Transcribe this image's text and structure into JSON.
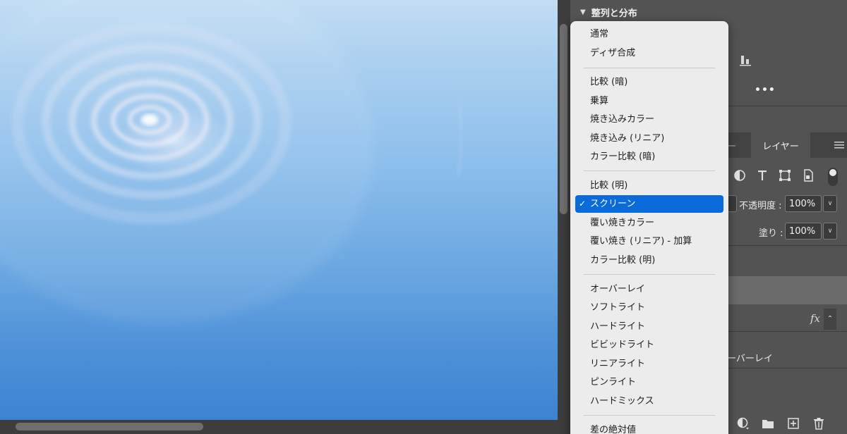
{
  "canvas": {
    "gradient_top": "#c2ddf3",
    "gradient_bottom": "#3d83d2"
  },
  "panel": {
    "section_title": "整列と分布",
    "tabs": {
      "previous_tab_fragment": "ー",
      "layers_tab": "レイヤー"
    },
    "opacity": {
      "label": "不透明度 :",
      "value": "100%"
    },
    "fill": {
      "label": "塗り :",
      "value": "100%"
    },
    "fx_label": "fx",
    "layer_effect_name": "ーバーレイ"
  },
  "blend_menu": {
    "items": [
      "通常",
      "ディザ合成",
      "比較 (暗)",
      "乗算",
      "焼き込みカラー",
      "焼き込み (リニア)",
      "カラー比較 (暗)",
      "比較 (明)",
      "スクリーン",
      "覆い焼きカラー",
      "覆い焼き (リニア) - 加算",
      "カラー比較 (明)",
      "オーバーレイ",
      "ソフトライト",
      "ハードライト",
      "ビビッドライト",
      "リニアライト",
      "ピンライト",
      "ハードミックス",
      "差の絶対値"
    ],
    "selected": "スクリーン",
    "check_mark": "✓",
    "accent_color": "#0a6ad9"
  },
  "icons": [
    "chevron-down-icon",
    "distribute-bottom-icon",
    "more-options-icon",
    "panel-menu-icon",
    "adjustment-icon",
    "type-icon",
    "transform-icon",
    "artboard-icon",
    "fx-icon",
    "new-group-icon",
    "new-layer-icon",
    "delete-icon"
  ]
}
